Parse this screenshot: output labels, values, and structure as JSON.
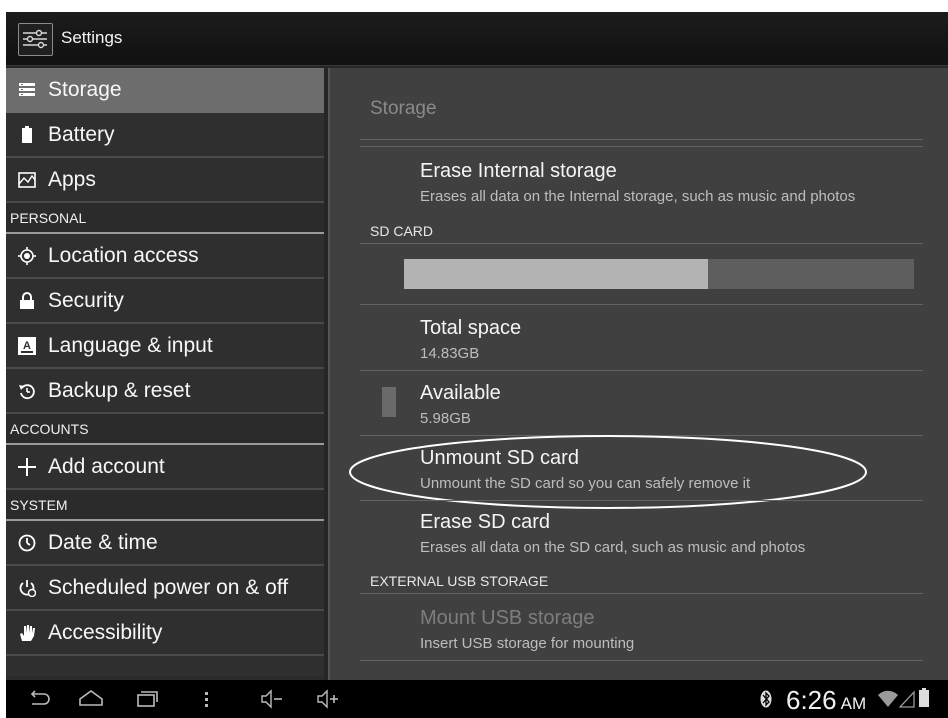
{
  "actionbar": {
    "title": "Settings",
    "icon": "settings-sliders-icon"
  },
  "menu": {
    "items_top": [
      {
        "label": "Storage",
        "icon": "storage-icon",
        "selected": true
      },
      {
        "label": "Battery",
        "icon": "battery-icon"
      },
      {
        "label": "Apps",
        "icon": "apps-icon"
      }
    ],
    "header_personal": "PERSONAL",
    "items_personal": [
      {
        "label": "Location access",
        "icon": "location-icon"
      },
      {
        "label": "Security",
        "icon": "lock-icon"
      },
      {
        "label": "Language & input",
        "icon": "keyboard-icon"
      },
      {
        "label": "Backup & reset",
        "icon": "backup-icon"
      }
    ],
    "header_accounts": "ACCOUNTS",
    "items_accounts": [
      {
        "label": "Add account",
        "icon": "plus-icon"
      }
    ],
    "header_system": "SYSTEM",
    "items_system": [
      {
        "label": "Date & time",
        "icon": "clock-icon"
      },
      {
        "label": "Scheduled power on & off",
        "icon": "power-schedule-icon"
      },
      {
        "label": "Accessibility",
        "icon": "hand-icon"
      }
    ]
  },
  "pane": {
    "title": "Storage",
    "erase_internal": {
      "title": "Erase Internal storage",
      "subtitle": "Erases all data on the Internal storage, such as music and photos"
    },
    "section_sd": "SD CARD",
    "sd_usage_fraction": 0.596,
    "total_space": {
      "title": "Total space",
      "value": "14.83GB"
    },
    "available": {
      "title": "Available",
      "value": "5.98GB"
    },
    "unmount_sd": {
      "title": "Unmount SD card",
      "subtitle": "Unmount the SD card so you can safely remove it"
    },
    "erase_sd": {
      "title": "Erase SD card",
      "subtitle": "Erases all data on the SD card, such as music and photos"
    },
    "section_usb": "EXTERNAL USB STORAGE",
    "mount_usb": {
      "title": "Mount USB storage",
      "subtitle": "Insert USB storage for mounting"
    }
  },
  "navbar": {
    "buttons": [
      "back-icon",
      "home-icon",
      "recent-apps-icon",
      "menu-dots-icon",
      "volume-down-icon",
      "volume-up-icon"
    ],
    "time": "6:26",
    "ampm": "AM",
    "status_icons": [
      "bluetooth-icon",
      "wifi-icon",
      "signal-icon",
      "battery-status-icon"
    ]
  },
  "colors": {
    "background": "#262626",
    "selected_item": "#6d6d6d",
    "pane": "#404040",
    "storage_used": "#b3b3b3",
    "storage_free": "#5e5e5e"
  }
}
